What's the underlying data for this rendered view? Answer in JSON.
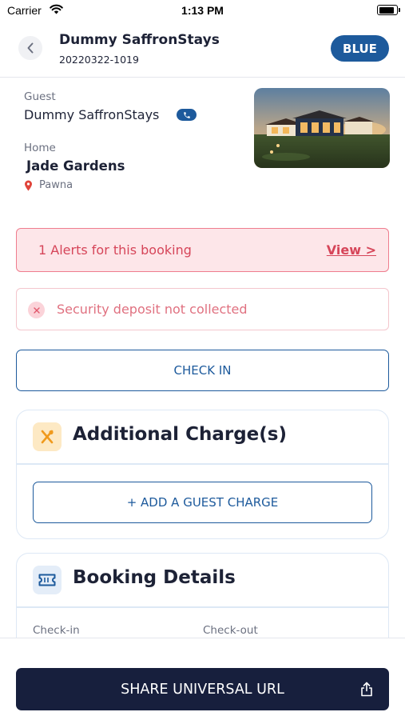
{
  "status_bar": {
    "carrier": "Carrier",
    "time": "1:13 PM"
  },
  "header": {
    "title": "Dummy SaffronStays",
    "booking_id": "20220322-1019",
    "tier_badge": "BLUE"
  },
  "guest": {
    "label": "Guest",
    "name": "Dummy SaffronStays"
  },
  "home": {
    "label": "Home",
    "name": "Jade Gardens",
    "location": "Pawna"
  },
  "alerts": {
    "summary": "1 Alerts for this booking",
    "view_link": "View >",
    "items": [
      "Security deposit not collected"
    ]
  },
  "actions": {
    "check_in": "CHECK IN",
    "share": "SHARE UNIVERSAL URL"
  },
  "additional_charges": {
    "title": "Additional Charge(s)",
    "add_button": "+ ADD A GUEST CHARGE"
  },
  "booking_details": {
    "title": "Booking Details",
    "check_in_label": "Check-in",
    "check_out_label": "Check-out"
  },
  "colors": {
    "brand_blue": "#1d5a9c",
    "navy": "#171f3d",
    "alert_red": "#d64559"
  },
  "icons": {
    "back": "chevron-left-icon",
    "phone": "phone-icon",
    "location": "map-pin-icon",
    "alert_dismiss": "close-icon",
    "charges": "utensils-icon",
    "booking": "ticket-icon",
    "share": "share-icon"
  }
}
